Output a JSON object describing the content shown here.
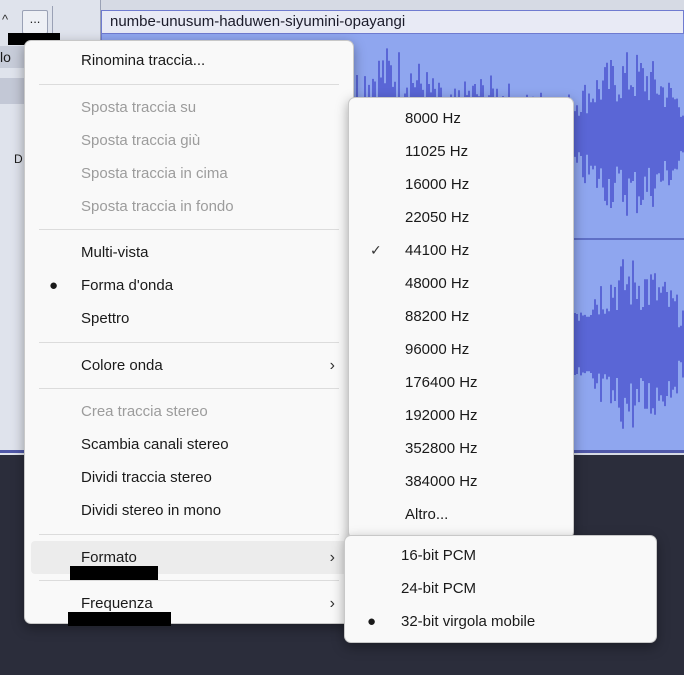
{
  "track": {
    "clip_name": "numbe-unusum-haduwen-siyumini-opayangi",
    "collapse_icon": "chevron-up-icon",
    "menu_button_label": "...",
    "header_label_lo": "lo",
    "header_label_d": "D"
  },
  "track_menu": {
    "rename": "Rinomina traccia...",
    "move_up": "Sposta traccia su",
    "move_down": "Sposta traccia giù",
    "move_top": "Sposta traccia in cima",
    "move_bottom": "Sposta traccia in fondo",
    "multi_view": "Multi-vista",
    "waveform": "Forma d'onda",
    "spectrogram": "Spettro",
    "wave_color": "Colore onda",
    "make_stereo": "Crea traccia stereo",
    "swap_channels": "Scambia canali stereo",
    "split_stereo": "Dividi traccia stereo",
    "split_stereo_mono": "Dividi stereo in mono",
    "format": "Formato",
    "rate": "Frequenza",
    "selected_view": "Forma d'onda"
  },
  "rate_menu": {
    "items": [
      "8000 Hz",
      "11025 Hz",
      "16000 Hz",
      "22050 Hz",
      "44100 Hz",
      "48000 Hz",
      "88200 Hz",
      "96000 Hz",
      "176400 Hz",
      "192000 Hz",
      "352800 Hz",
      "384000 Hz",
      "Altro..."
    ],
    "selected": "44100 Hz"
  },
  "format_menu": {
    "items": [
      "16-bit PCM",
      "24-bit PCM",
      "32-bit virgola mobile"
    ],
    "selected": "32-bit virgola mobile"
  },
  "colors": {
    "waveform": "#5a66d6",
    "clip_background": "#8fa6ef",
    "menu_background": "#f9f9f9",
    "disabled_text": "#9c9c9c"
  }
}
